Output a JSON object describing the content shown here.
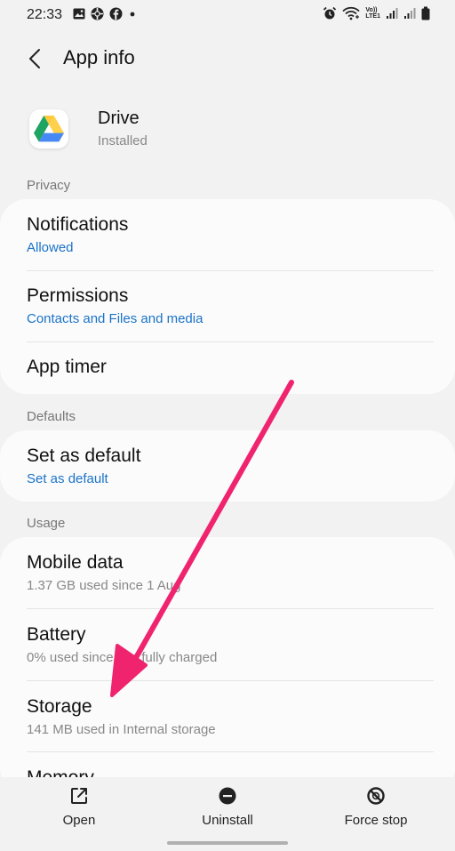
{
  "status_bar": {
    "time": "22:33",
    "left_icons": [
      "gallery-icon",
      "game-icon",
      "facebook-icon",
      "dot-icon"
    ],
    "right_icons": [
      "alarm-icon",
      "wifi-icon",
      "volte-icon",
      "signal-icon",
      "signal-icon",
      "battery-icon"
    ],
    "volte_top": "Vo))",
    "volte_bottom": "LTE1"
  },
  "header": {
    "title": "App info"
  },
  "app": {
    "name": "Drive",
    "status": "Installed",
    "icon": "google-drive-icon",
    "colors": {
      "green": "#1fa463",
      "yellow": "#ffd04b",
      "blue": "#4688f4"
    }
  },
  "sections": {
    "privacy": {
      "header": "Privacy",
      "notifications": {
        "title": "Notifications",
        "sub": "Allowed"
      },
      "permissions": {
        "title": "Permissions",
        "sub": "Contacts and Files and media"
      },
      "app_timer": {
        "title": "App timer"
      }
    },
    "defaults": {
      "header": "Defaults",
      "set_as_default": {
        "title": "Set as default",
        "sub": "Set as default"
      }
    },
    "usage": {
      "header": "Usage",
      "mobile_data": {
        "title": "Mobile data",
        "sub": "1.37 GB used since 1 Aug"
      },
      "battery": {
        "title": "Battery",
        "sub": "0% used since last fully charged"
      },
      "storage": {
        "title": "Storage",
        "sub": "141 MB used in Internal storage"
      },
      "memory": {
        "title": "Memory"
      }
    }
  },
  "bottom_actions": {
    "open": {
      "label": "Open",
      "icon": "open-external-icon"
    },
    "uninstall": {
      "label": "Uninstall",
      "icon": "uninstall-icon"
    },
    "force_stop": {
      "label": "Force stop",
      "icon": "force-stop-icon"
    }
  },
  "colors": {
    "link_blue": "#1a73c8",
    "annotation_arrow": "#f0246e",
    "background": "#f2f2f2",
    "card": "#fbfbfb"
  }
}
